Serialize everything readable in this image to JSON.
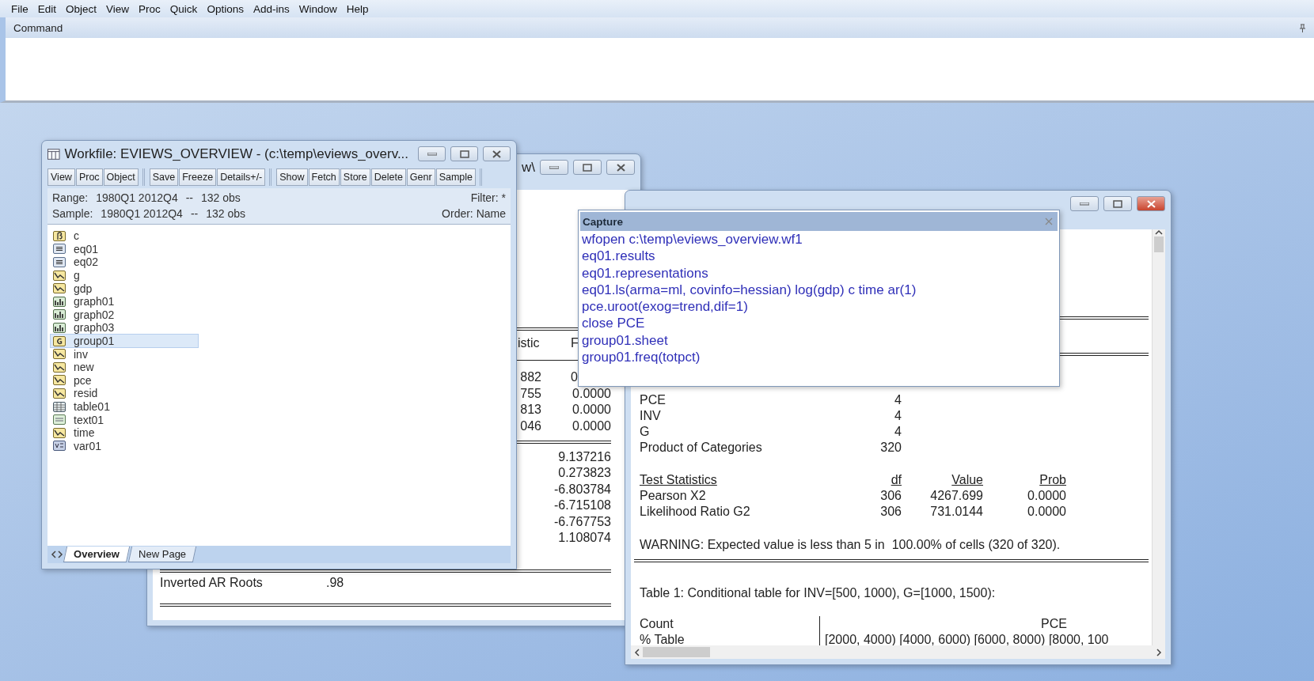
{
  "menu": [
    "File",
    "Edit",
    "Object",
    "View",
    "Proc",
    "Quick",
    "Options",
    "Add-ins",
    "Window",
    "Help"
  ],
  "command_pane": {
    "title": "Command"
  },
  "workfile": {
    "title": "Workfile: EVIEWS_OVERVIEW - (c:\\temp\\eviews_overv...",
    "toolbar": [
      [
        "View",
        "Proc",
        "Object"
      ],
      [
        "Save",
        "Freeze",
        "Details+/-"
      ],
      [
        "Show",
        "Fetch",
        "Store",
        "Delete",
        "Genr",
        "Sample"
      ]
    ],
    "info": [
      {
        "label": "Range:",
        "dates": "1980Q1 2012Q4",
        "sep": "--",
        "obs": "132 obs",
        "right": "Filter: *"
      },
      {
        "label": "Sample:",
        "dates": "1980Q1 2012Q4",
        "sep": "--",
        "obs": "132 obs",
        "right": "Order: Name"
      }
    ],
    "objects": [
      {
        "name": "c",
        "kind": "coef",
        "selected": false
      },
      {
        "name": "eq01",
        "kind": "equation",
        "selected": false
      },
      {
        "name": "eq02",
        "kind": "equation",
        "selected": false
      },
      {
        "name": "g",
        "kind": "series",
        "selected": false
      },
      {
        "name": "gdp",
        "kind": "series",
        "selected": false
      },
      {
        "name": "graph01",
        "kind": "graph",
        "selected": false
      },
      {
        "name": "graph02",
        "kind": "graph",
        "selected": false
      },
      {
        "name": "graph03",
        "kind": "graph",
        "selected": false
      },
      {
        "name": "group01",
        "kind": "group",
        "selected": true
      },
      {
        "name": "inv",
        "kind": "series",
        "selected": false
      },
      {
        "name": "new",
        "kind": "series",
        "selected": false
      },
      {
        "name": "pce",
        "kind": "series",
        "selected": false
      },
      {
        "name": "resid",
        "kind": "series",
        "selected": false
      },
      {
        "name": "table01",
        "kind": "table",
        "selected": false
      },
      {
        "name": "text01",
        "kind": "text",
        "selected": false
      },
      {
        "name": "time",
        "kind": "series",
        "selected": false
      },
      {
        "name": "var01",
        "kind": "var",
        "selected": false
      }
    ],
    "page_tabs": [
      {
        "label": "Overview",
        "selected": true
      },
      {
        "label": "New Page",
        "selected": false
      }
    ]
  },
  "equation_window": {
    "title": "w\\",
    "header": [
      "istic",
      "F"
    ],
    "rows": [
      [
        "882",
        "0"
      ],
      [
        "755",
        "0.0000"
      ],
      [
        "813",
        "0.0000"
      ],
      [
        "046",
        "0.0000"
      ]
    ],
    "stats": [
      "9.137216",
      "0.273823",
      "-6.803784",
      "-6.715108",
      "-6.767753",
      "1.108074"
    ],
    "roots": {
      "label": "Inverted AR Roots",
      "value": ".98"
    }
  },
  "freq_window": {
    "categories": [
      [
        "PCE",
        "4"
      ],
      [
        "INV",
        "4"
      ],
      [
        "G",
        "4"
      ],
      [
        "Product of Categories",
        "320"
      ]
    ],
    "test_header": [
      "Test Statistics",
      "df",
      "Value",
      "Prob"
    ],
    "tests": [
      [
        "Pearson X2",
        "306",
        "4267.699",
        "0.0000"
      ],
      [
        "Likelihood Ratio G2",
        "306",
        "731.0144",
        "0.0000"
      ]
    ],
    "warning": "WARNING: Expected value is less than 5 in  100.00% of cells (320 of 320).",
    "table_title": "Table 1: Conditional table for INV=[500, 1000), G=[1000, 1500):",
    "count_label": "Count",
    "pct_label": "% Table",
    "col_var": "PCE",
    "col_ranges": "[2000, 4000) [4000, 6000) [6000, 8000) [8000, 100"
  },
  "capture": {
    "title": "Capture",
    "lines": [
      "wfopen c:\\temp\\eviews_overview.wf1",
      "eq01.results",
      "eq01.representations",
      "eq01.ls(arma=ml, covinfo=hessian) log(gdp) c time ar(1)",
      "pce.uroot(exog=trend,dif=1)",
      "close PCE",
      "group01.sheet",
      "group01.freq(totpct)"
    ]
  }
}
